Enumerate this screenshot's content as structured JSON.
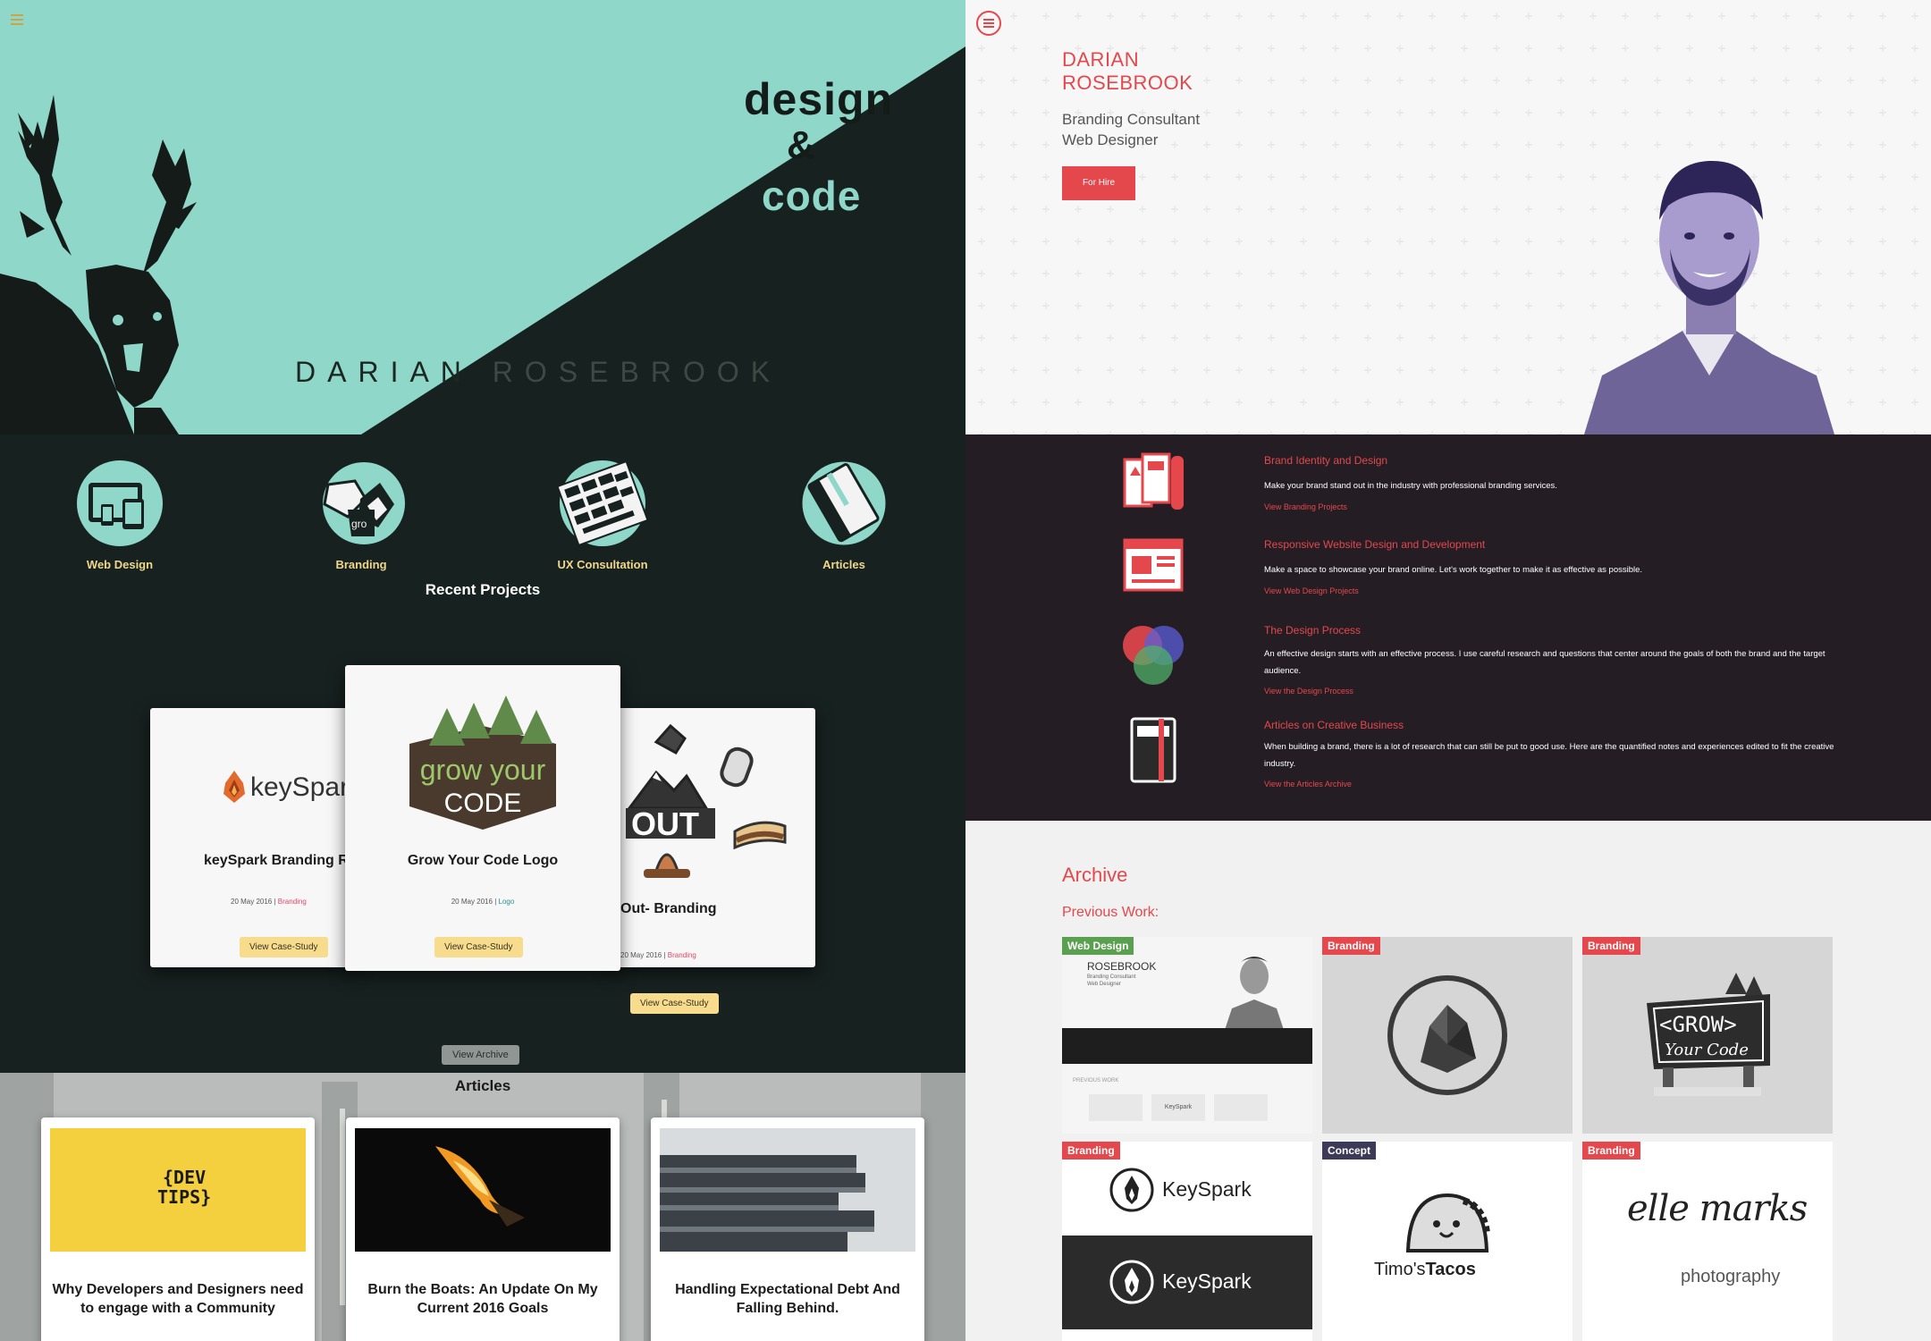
{
  "left": {
    "hero": {
      "tagline": {
        "design": "design",
        "amp": "&",
        "code": "code"
      },
      "name_first": "DARIAN ",
      "name_last": "ROSEBROOK"
    },
    "services": [
      {
        "label": "Web Design",
        "icon": "devices-icon"
      },
      {
        "label": "Branding",
        "icon": "branding-icon"
      },
      {
        "label": "UX Consultation",
        "icon": "ux-wireframes-icon"
      },
      {
        "label": "Articles",
        "icon": "notebook-icon"
      }
    ],
    "recent_title": "Recent Projects",
    "projects": [
      {
        "title": "keySpark Branding Rec",
        "logo_text": "keySpark",
        "date": "20 May 2016",
        "category": "Branding",
        "button": "View Case-Study"
      },
      {
        "title": "Grow Your Code Logo",
        "logo_line1": "grow your",
        "logo_line2": "CODE",
        "date": "20 May 2016",
        "category": "Logo",
        "button": "View Case-Study"
      },
      {
        "title": "Out- Branding",
        "logo_text": "OUT",
        "date": "20 May 2016",
        "category": "Branding",
        "button": "View Case-Study"
      }
    ],
    "view_archive": "View Archive",
    "articles_title": "Articles",
    "articles": [
      {
        "title": "Why Developers and Designers need to engage with a Community",
        "image_text_1": "{DEV",
        "image_text_2": "TIPS}"
      },
      {
        "title": "Burn the Boats: An Update On My Current 2016 Goals"
      },
      {
        "title": "Handling Expectational Debt And Falling Behind."
      }
    ],
    "separator": " | "
  },
  "right": {
    "name_line1": "DARIAN",
    "name_line2": "ROSEBROOK",
    "role1": "Branding Consultant",
    "role2": "Web Designer",
    "for_hire": "For Hire",
    "services": [
      {
        "heading": "Brand Identity and Design",
        "desc": "Make your brand stand out in the industry with professional branding services.",
        "link": "View Branding Projects",
        "icon": "brand-identity-icon"
      },
      {
        "heading": "Responsive Website Design and Development",
        "desc": "Make a space to showcase your brand online. Let's work together to make it as effective as possible.",
        "link": "View Web Design Projects",
        "icon": "browser-window-icon"
      },
      {
        "heading": "The Design Process",
        "desc": "An effective design starts with an effective process. I use careful research and questions that center around the goals of both the brand and the target audience.",
        "link": "View the Design Process",
        "icon": "venn-circles-icon"
      },
      {
        "heading": "Articles on Creative Business",
        "desc": "When building a brand, there is a lot of research that can still be put to good use. Here are the quantified notes and experiences edited to fit the creative industry.",
        "link": "View the Articles Archive",
        "icon": "notebook-icon"
      }
    ],
    "archive_title": "Archive",
    "archive_sub": "Previous Work:",
    "tiles": [
      {
        "tag": "Web Design",
        "mini_name": "ROSEBROOK",
        "mini_role1": "Branding Consultant",
        "mini_role2": "Web Designer",
        "mini_prev": "PREVIOUS WORK",
        "mini_keyspark": "KeySpark"
      },
      {
        "tag": "Branding"
      },
      {
        "tag": "Branding",
        "logo_line1": "<GROW>",
        "logo_line2": "Your Code"
      },
      {
        "tag": "Branding",
        "logo_text": "KeySpark"
      },
      {
        "tag": "Concept",
        "logo_text_1": "Timo's",
        "logo_text_2": "Tacos"
      },
      {
        "tag": "Branding",
        "logo_text_1": "elle marks",
        "logo_text_2": "photography"
      }
    ]
  }
}
